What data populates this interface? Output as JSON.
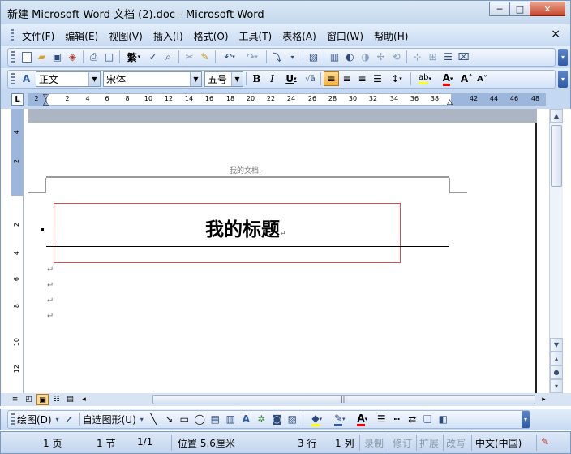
{
  "window": {
    "title": "新建 Microsoft Word 文档 (2).doc - Microsoft Word",
    "minimize": "─",
    "maximize": "□",
    "close": "✕"
  },
  "menu": {
    "items": [
      "文件(F)",
      "编辑(E)",
      "视图(V)",
      "插入(I)",
      "格式(O)",
      "工具(T)",
      "表格(A)",
      "窗口(W)",
      "帮助(H)"
    ],
    "doc_close": "×"
  },
  "formatting": {
    "style_value": "正文",
    "font_value": "宋体",
    "size_value": "五号",
    "traditional_label": "繁"
  },
  "ruler": {
    "corner": "L",
    "numbers": [
      "2",
      "2",
      "4",
      "6",
      "8",
      "10",
      "12",
      "14",
      "16",
      "18",
      "20",
      "22",
      "24",
      "26",
      "28",
      "30",
      "32",
      "34",
      "36",
      "38",
      "42",
      "44",
      "46",
      "48"
    ]
  },
  "vruler": {
    "numbers": [
      "4",
      "2",
      "2",
      "4",
      "6",
      "8",
      "10",
      "12"
    ]
  },
  "document": {
    "header_text": "我的文档.",
    "title_text": "我的标题",
    "paragraph_mark": "↵"
  },
  "drawing": {
    "draw_label": "绘图(D)",
    "autoshapes_label": "自选图形(U)"
  },
  "status": {
    "page": "1 页",
    "section": "1 节",
    "page_count": "1/1",
    "position": "位置 5.6厘米",
    "line": "3 行",
    "column": "1 列",
    "rec": "录制",
    "trk": "修订",
    "ext": "扩展",
    "ovr": "改写",
    "language": "中文(中国)"
  },
  "colors": {
    "accent_blue": "#2f5aa6",
    "title_box_border": "#e24a4a",
    "highlight_yellow": "#ffff00",
    "font_color_red": "#ff0000"
  }
}
